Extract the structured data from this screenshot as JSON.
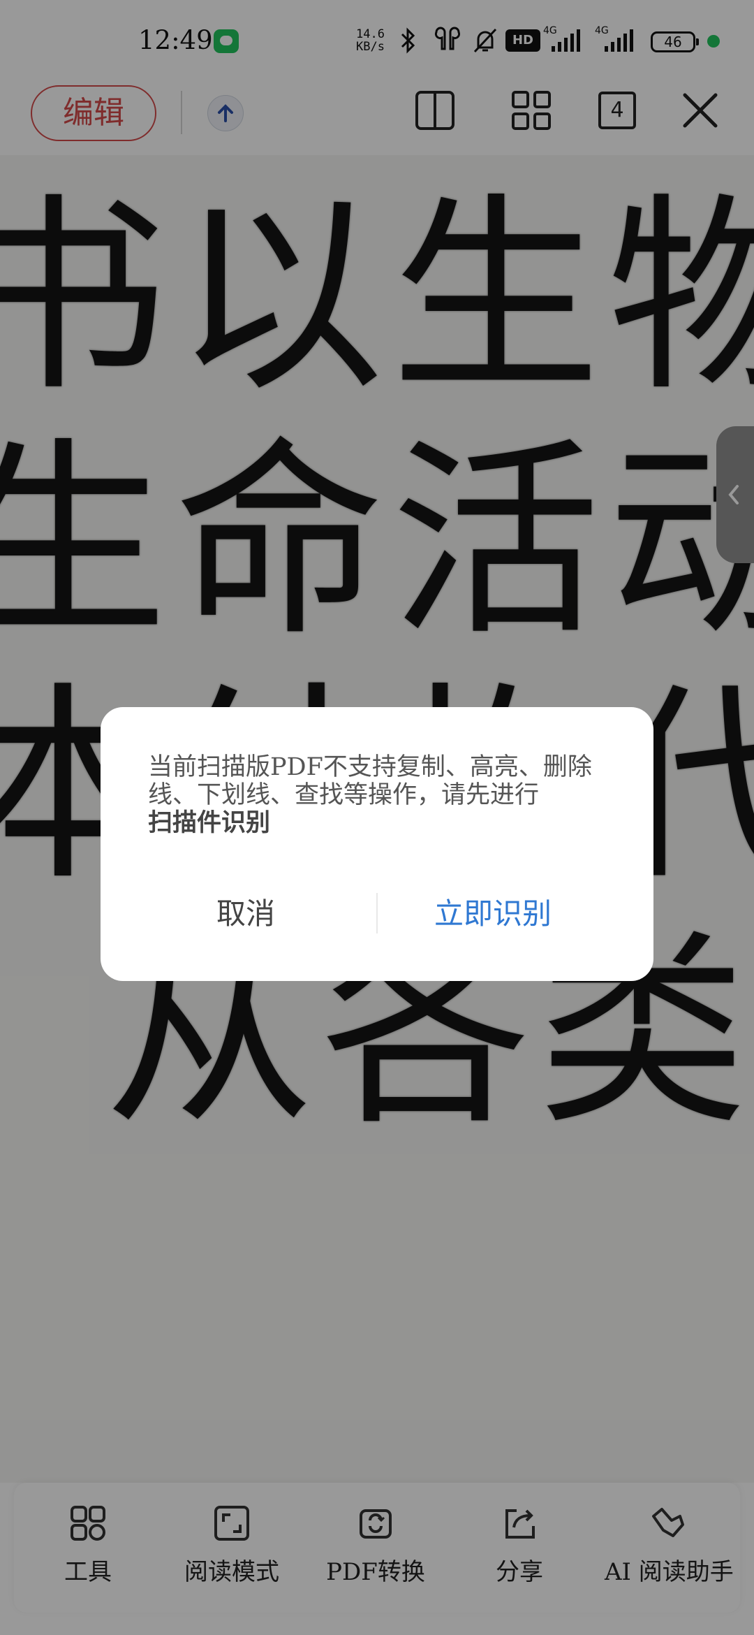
{
  "status_bar": {
    "time": "12:49",
    "net_speed_value": "14.6",
    "net_speed_unit": "KB/s",
    "hd_label": "HD",
    "signal_1_label": "4G",
    "signal_2_label": "4G",
    "battery": "46"
  },
  "toolbar": {
    "edit_label": "编辑",
    "page_badge": "4"
  },
  "document": {
    "rows": [
      "书以生物",
      "生命活动",
      "本结构代",
      "从各类"
    ]
  },
  "dialog": {
    "message": "当前扫描版PDF不支持复制、高亮、删除线、下划线、查找等操作，请先进行",
    "message_strong": "扫描件识别",
    "cancel_label": "取消",
    "confirm_label": "立即识别"
  },
  "bottom_bar": {
    "items": [
      {
        "label": "工具",
        "icon": "tools-icon"
      },
      {
        "label": "阅读模式",
        "icon": "read-mode-icon"
      },
      {
        "label": "PDF转换",
        "icon": "pdf-convert-icon"
      },
      {
        "label": "分享",
        "icon": "share-icon"
      },
      {
        "label": "AI  阅读助手",
        "icon": "ai-assistant-icon"
      }
    ]
  },
  "colors": {
    "edit_red": "#d44a4a",
    "confirm_blue": "#2f78d2",
    "overlay": "rgba(0,0,0,0.40)"
  }
}
